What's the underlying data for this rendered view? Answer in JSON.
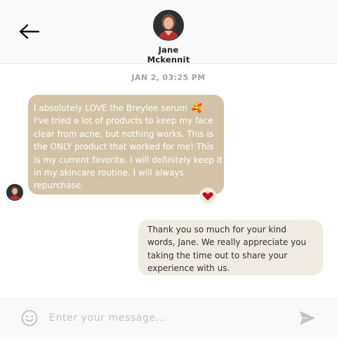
{
  "header": {
    "contact_name": "Jane Mckennit",
    "back_icon": "arrow-left-icon"
  },
  "thread": {
    "timestamp": "JAN 2, 03:25 PM",
    "incoming": {
      "lines": [
        "I absolutely LOVE the Breylee serum",
        "I've tried a lot of products to keep my face",
        "clear from acne, but nothing works. This is",
        "the ONLY product that worked for me! This",
        "is my current favorite. I will definitely keep it",
        "in my skincare routine. I will always",
        "repurchase."
      ],
      "emoji": "🥰",
      "reaction_icon": "heart-icon",
      "bubble_color": "#d3c3a6"
    },
    "outgoing": {
      "lines": [
        "Thank you so much for your kind",
        "words, Jane. We really appreciate you",
        "taking the time out to share your",
        "experience with us."
      ],
      "bubble_color": "#efebe3"
    }
  },
  "composer": {
    "placeholder": "Enter your message...",
    "value": "",
    "emoji_icon": "smile-icon",
    "send_icon": "send-icon"
  },
  "colors": {
    "reaction_heart": "#d0021b",
    "timestamp": "#a3a3a3"
  }
}
